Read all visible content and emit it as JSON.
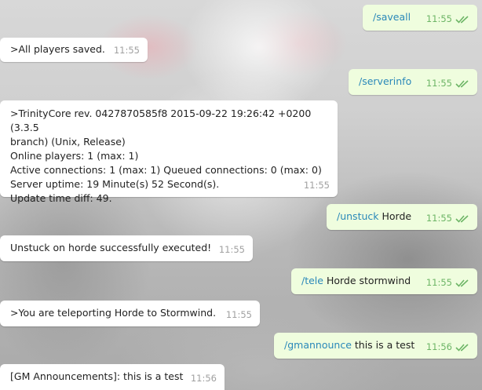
{
  "chat": {
    "messages": [
      {
        "side": "out",
        "command": "/saveall",
        "rest": "",
        "time": "11:55"
      },
      {
        "side": "in",
        "text": ">All players saved.",
        "time": "11:55"
      },
      {
        "side": "out",
        "command": "/serverinfo",
        "rest": "",
        "time": "11:55"
      },
      {
        "side": "in",
        "lines": [
          ">TrinityCore rev. 0427870585f8 2015-09-22 19:26:42 +0200 (3.3.5",
          "branch) (Unix, Release)",
          "Online players: 1 (max: 1)",
          "Active connections: 1 (max: 1) Queued connections: 0 (max: 0)",
          "Server uptime: 19 Minute(s) 52 Second(s).",
          "Update time diff: 49."
        ],
        "time": "11:55"
      },
      {
        "side": "out",
        "command": "/unstuck",
        "rest": " Horde",
        "time": "11:55"
      },
      {
        "side": "in",
        "text": "Unstuck on horde successfully executed!",
        "time": "11:55"
      },
      {
        "side": "out",
        "command": "/tele",
        "rest": " Horde stormwind",
        "time": "11:55"
      },
      {
        "side": "in",
        "text": ">You are teleporting Horde to Stormwind.",
        "time": "11:55"
      },
      {
        "side": "out",
        "command": "/gmannounce",
        "rest": " this is a test",
        "time": "11:56"
      },
      {
        "side": "in",
        "text": "[GM Announcements]: this is a test",
        "time": "11:56"
      }
    ]
  },
  "icons": {
    "read_receipt": "double-check-icon"
  },
  "colors": {
    "incoming_bubble": "#ffffff",
    "outgoing_bubble": "#effdde",
    "command_link": "#2a88b9",
    "outgoing_meta": "#6db566",
    "incoming_meta": "#a0a0a0"
  }
}
